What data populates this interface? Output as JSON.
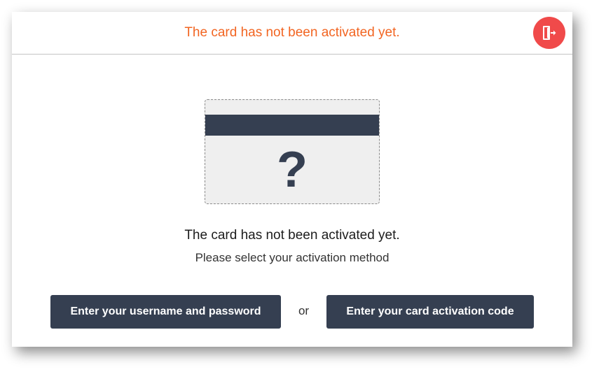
{
  "header": {
    "title": "The card has not been activated yet.",
    "exit_icon": "exit-door-icon",
    "accent_color": "#f26522",
    "exit_button_color": "#f04a4a"
  },
  "card": {
    "symbol": "?",
    "icon": "unknown-card-icon"
  },
  "message": {
    "title": "The card has not been activated yet.",
    "subtitle": "Please select your activation method"
  },
  "actions": {
    "login_label": "Enter your username and password",
    "separator": "or",
    "code_label": "Enter your card activation code",
    "button_color": "#353f51"
  }
}
